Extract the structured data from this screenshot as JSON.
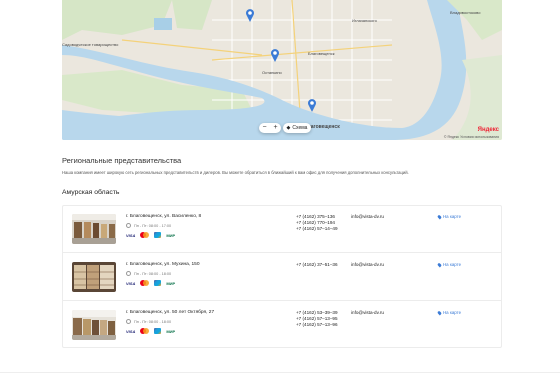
{
  "map": {
    "labels": {
      "vlad": "Владивостоково",
      "blag": "Благовещенск",
      "center": "Благовещенск",
      "ostov": "Останкино",
      "area": "Садоводческое товарищество",
      "road": "Иглачанского"
    },
    "zoom_minus": "−",
    "zoom_plus": "+",
    "layers_label": "Схема",
    "brand": "Яндекс",
    "copyright": "© Яндекс Условия использования"
  },
  "section": {
    "title": "Региональные представительства",
    "description": "Наша компания имеет широкую сеть региональных представительств и дилеров. Вы можете обратиться в ближайший к вам офис для получения дополнительных консультаций.",
    "region": "Амурская область"
  },
  "offices": [
    {
      "address": "г. Благовещенск, ул. Василенко, 8",
      "hours": "Пн - Пт: 08:00 - 17:00",
      "phones": [
        "+7 (4162) 375–136",
        "+7 (4162) 770–194",
        "+7 (4162) 57–14–49"
      ],
      "email": "info@vista-dv.ru",
      "map_link": "На карте"
    },
    {
      "address": "г. Благовещенск, ул. Мухина, 150",
      "hours": "Пн - Пт: 08:00 - 18:00",
      "phones": [
        "+7 (4162) 37–51–36"
      ],
      "email": "info@vista-dv.ru",
      "map_link": "На карте"
    },
    {
      "address": "г. Благовещенск, ул. 50 лет Октября, 27",
      "hours": "Пн - Пт: 08:00 - 18:00",
      "phones": [
        "+7 (4162) 53–39–39",
        "+7 (4162) 57–13–95",
        "+7 (4162) 57–13–96"
      ],
      "email": "info@vista-dv.ru",
      "map_link": "На карте"
    }
  ],
  "payments": {
    "visa": "VISA",
    "mir": "МИР"
  },
  "colors": {
    "accent": "#3b7bd6",
    "river": "#b9d8ec",
    "land": "#ece8df",
    "green": "#cfe3bf"
  }
}
